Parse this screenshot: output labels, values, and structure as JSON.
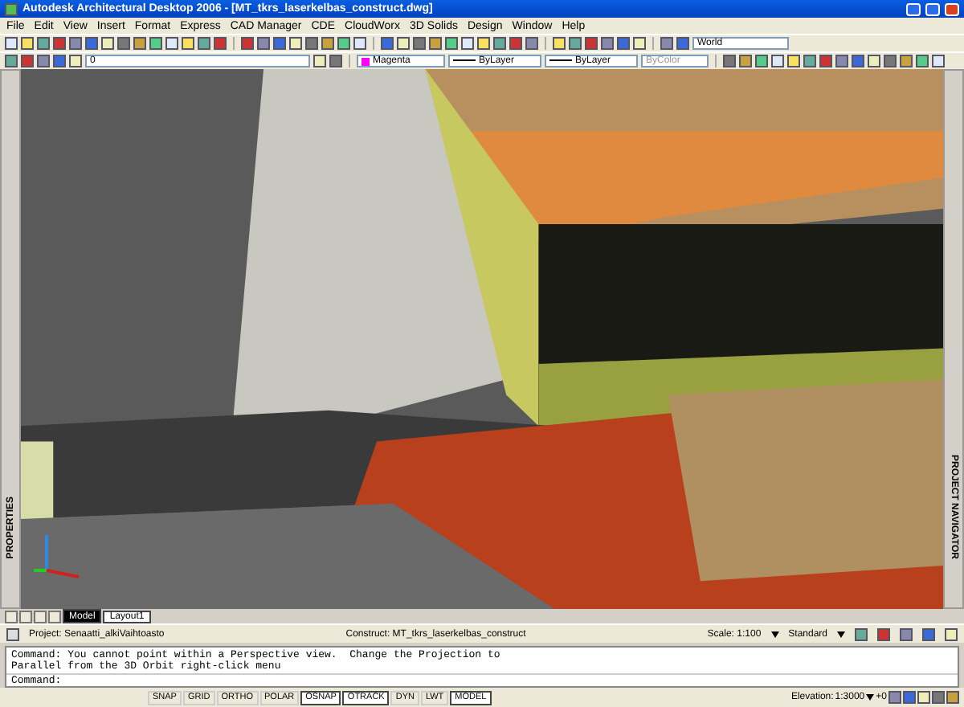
{
  "window": {
    "title": "Autodesk Architectural Desktop 2006 - [MT_tkrs_laserkelbas_construct.dwg]"
  },
  "menu": [
    "File",
    "Edit",
    "View",
    "Insert",
    "Format",
    "Express",
    "CAD Manager",
    "CDE",
    "CloudWorx",
    "3D Solids",
    "Design",
    "Window",
    "Help"
  ],
  "toolbar": {
    "layer": "0",
    "color_style": "Magenta",
    "linetype": "ByLayer",
    "lineweight": "ByLayer",
    "plotstyle": "ByColor",
    "ucs": "World"
  },
  "palettes": {
    "left": "PROPERTIES",
    "right": "PROJECT NAVIGATOR"
  },
  "layout_tabs": [
    {
      "label": "Model",
      "selected": true
    },
    {
      "label": "Layout1",
      "selected": false
    }
  ],
  "project_bar": {
    "project": "Project: Senaatti_alkiVaihtoasto",
    "construct": "Construct: MT_tkrs_laserkelbas_construct",
    "scale": "Scale: 1:100",
    "display": "Standard"
  },
  "command": {
    "history": [
      "Command: You cannot point within a Perspective view.  Change the Projection to",
      "Parallel from the 3D Orbit right-click menu"
    ],
    "prompt": "Command:"
  },
  "status": {
    "toggles": [
      {
        "label": "SNAP",
        "on": false
      },
      {
        "label": "GRID",
        "on": false
      },
      {
        "label": "ORTHO",
        "on": false
      },
      {
        "label": "POLAR",
        "on": false
      },
      {
        "label": "OSNAP",
        "on": true
      },
      {
        "label": "OTRACK",
        "on": true
      },
      {
        "label": "DYN",
        "on": false
      },
      {
        "label": "LWT",
        "on": false
      },
      {
        "label": "MODEL",
        "on": true
      }
    ],
    "elevation": "Elevation:",
    "elevation_scale": "1:3000",
    "offset": "+0"
  }
}
